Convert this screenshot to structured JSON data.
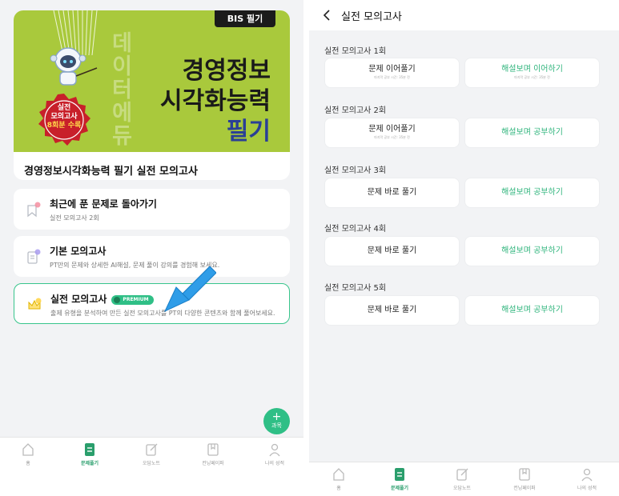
{
  "left": {
    "hero": {
      "tag": "BIS 필기",
      "line1": "경영정보",
      "line2": "시각화능력",
      "line3": "필기",
      "watermark": "데이터에듀",
      "seal_line1": "실전",
      "seal_line2": "모의고사",
      "seal_line3": "8회분 수록",
      "title": "경영정보시각화능력 필기 실전 모의고사"
    },
    "cards": [
      {
        "title": "최근에 푼 문제로 돌아가기",
        "subtitle": "실전 모의고사 2회",
        "icon": "bookmark-icon"
      },
      {
        "title": "기본 모의고사",
        "subtitle": "PT만의 문제와 상세한 AI해설, 문제 풀이 강의를 경험해 보세요.",
        "icon": "document-icon"
      },
      {
        "title": "실전 모의고사",
        "badge": "PREMIUM",
        "subtitle": "출제 유형을 분석하여 만든 실전 모의고사를 PT의 다양한 콘텐츠와 함께 풀어보세요.",
        "icon": "crown-icon"
      }
    ],
    "fab": {
      "plus": "+",
      "label": "과목"
    },
    "tabs": [
      {
        "label": "홈",
        "icon": "home-icon"
      },
      {
        "label": "문제풀기",
        "icon": "quiz-icon"
      },
      {
        "label": "오답노트",
        "icon": "note-icon"
      },
      {
        "label": "컨닝페이퍼",
        "icon": "cheatsheet-icon"
      },
      {
        "label": "나의 성적",
        "icon": "profile-icon"
      }
    ],
    "active_tab": "문제풀기"
  },
  "right": {
    "title": "실전 모의고사",
    "sections": [
      {
        "label": "실전 모의고사 1회",
        "left_label": "문제 이어풀기",
        "left_sub": "마지막 공부 시간: 35분 전",
        "right_label": "해설보며 이어하기",
        "right_sub": "마지막 공부 시간: 35분 전"
      },
      {
        "label": "실전 모의고사 2회",
        "left_label": "문제 이어풀기",
        "left_sub": "마지막 공부 시간: 35분 전",
        "right_label": "해설보며 공부하기"
      },
      {
        "label": "실전 모의고사 3회",
        "left_label": "문제 바로 풀기",
        "right_label": "해설보며 공부하기"
      },
      {
        "label": "실전 모의고사 4회",
        "left_label": "문제 바로 풀기",
        "right_label": "해설보며 공부하기"
      },
      {
        "label": "실전 모의고사 5회",
        "left_label": "문제 바로 풀기",
        "right_label": "해설보며 공부하기"
      }
    ],
    "tabs": [
      {
        "label": "홈",
        "icon": "home-icon"
      },
      {
        "label": "문제풀기",
        "icon": "quiz-icon"
      },
      {
        "label": "오답노트",
        "icon": "note-icon"
      },
      {
        "label": "컨닝페이퍼",
        "icon": "cheatsheet-icon"
      },
      {
        "label": "나의 성적",
        "icon": "profile-icon"
      }
    ],
    "active_tab": "문제풀기"
  },
  "colors": {
    "accent": "#2fbf86",
    "hero_bg": "#a9c93c",
    "title_blue": "#2a3f96",
    "seal_red": "#c8202a"
  }
}
